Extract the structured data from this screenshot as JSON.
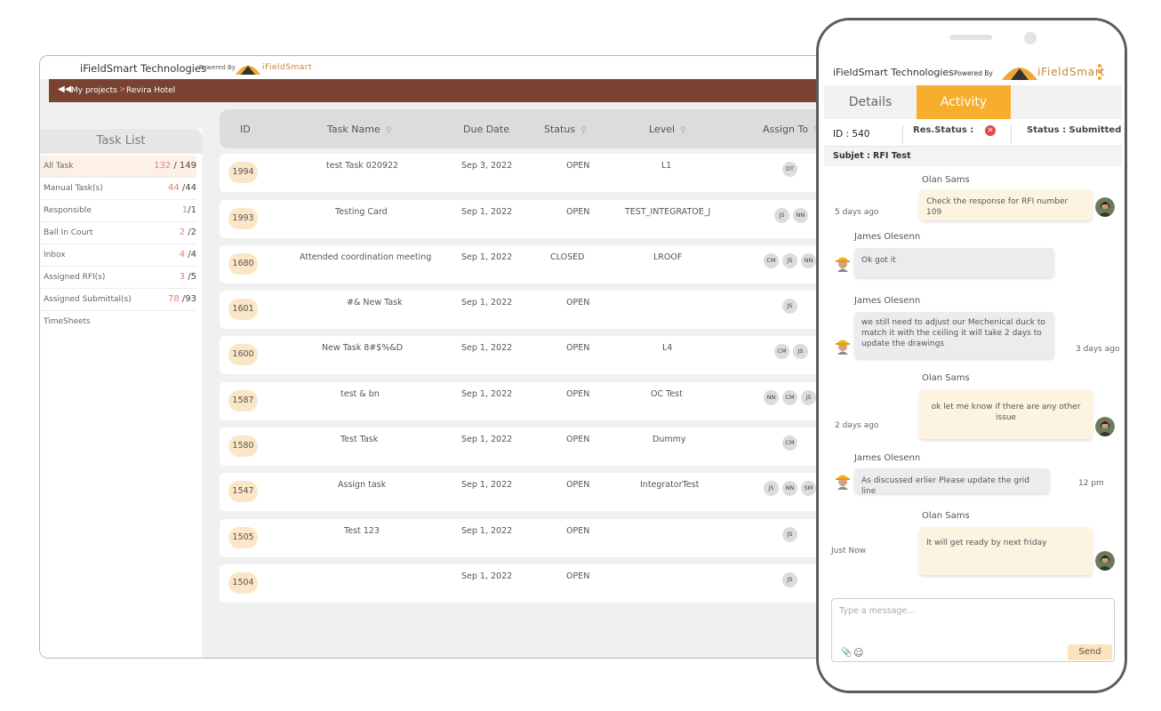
{
  "desktop": {
    "company": "iFieldSmart Technologies",
    "powered_by": "Powered By",
    "logo_text": "iFieldSmart",
    "breadcrumb": {
      "back_icon": "double-left-arrow-icon",
      "parent": "My projects",
      "separator": ">",
      "current": "Revira Hotel"
    },
    "task_list": {
      "title": "Task List",
      "items": [
        {
          "label": "All Task",
          "count": "132",
          "total": "149"
        },
        {
          "label": "Manual Task(s)",
          "count": "44",
          "total": "44"
        },
        {
          "label": "Responsible",
          "count": "1",
          "total": "1"
        },
        {
          "label": "Ball In Court",
          "count": "2",
          "total": "2"
        },
        {
          "label": "Inbox",
          "count": "4",
          "total": "4"
        },
        {
          "label": "Assigned RFI(s)",
          "count": "3",
          "total": "5"
        },
        {
          "label": "Assigned Submittal(s)",
          "count": "78",
          "total": "93"
        },
        {
          "label": "TimeSheets",
          "count": "",
          "total": ""
        }
      ]
    },
    "table": {
      "headers": {
        "id": "ID",
        "task_name": "Task Name",
        "due_date": "Due Date",
        "status": "Status",
        "level": "Level",
        "assign_to": "Assign To"
      },
      "rows": [
        {
          "id": "1994",
          "name": "test Task 020922",
          "due": "Sep 3, 2022",
          "status": "OPEN",
          "level": "L1",
          "assignees": [
            "DT"
          ]
        },
        {
          "id": "1993",
          "name": "Testing Card",
          "due": "Sep 1, 2022",
          "status": "OPEN",
          "level": "TEST_INTEGRATOE_J",
          "assignees": [
            "JS",
            "NN"
          ]
        },
        {
          "id": "1680",
          "name": "Attended coordination meeting",
          "due": "Sep 1, 2022",
          "status": "CLOSED",
          "level": "LROOF",
          "assignees": [
            "CM",
            "JS",
            "NN"
          ]
        },
        {
          "id": "1601",
          "name": "#& New Task",
          "due": "Sep 1, 2022",
          "status": "OPEN",
          "level": "",
          "assignees": [
            "JS"
          ]
        },
        {
          "id": "1600",
          "name": "New Task 8#$%&D",
          "due": "Sep 1, 2022",
          "status": "OPEN",
          "level": "L4",
          "assignees": [
            "CM",
            "JS"
          ]
        },
        {
          "id": "1587",
          "name": "test & bn",
          "due": "Sep 1, 2022",
          "status": "OPEN",
          "level": "OC Test",
          "assignees": [
            "NN",
            "CM",
            "JS"
          ]
        },
        {
          "id": "1580",
          "name": "Test Task",
          "due": "Sep 1, 2022",
          "status": "OPEN",
          "level": "Dummy",
          "assignees": [
            "CM"
          ]
        },
        {
          "id": "1547",
          "name": "Assign task",
          "due": "Sep 1, 2022",
          "status": "OPEN",
          "level": "IntegratorTest",
          "assignees": [
            "JS",
            "NN",
            "SM"
          ]
        },
        {
          "id": "1505",
          "name": "Test 123",
          "due": "Sep 1, 2022",
          "status": "OPEN",
          "level": "",
          "assignees": [
            "JS"
          ]
        },
        {
          "id": "1504",
          "name": "",
          "due": "Sep 1, 2022",
          "status": "OPEN",
          "level": "",
          "assignees": [
            "JS"
          ]
        }
      ]
    }
  },
  "phone": {
    "company": "iFieldSmart Technologies",
    "powered_by": "Powered By",
    "logo_text": "iFieldSmart",
    "tabs": {
      "details": "Details",
      "activity": "Activity"
    },
    "info": {
      "id": "ID : 540",
      "res_status": "Res.Status :",
      "status": "Status : Submitted"
    },
    "subject": "Subjet : RFI Test",
    "messages": [
      {
        "sender": "Olan Sams",
        "text": "Check the response for RFI number 109",
        "time": "5 days ago"
      },
      {
        "sender": "James Olesenn",
        "text": "Ok got it",
        "time": ""
      },
      {
        "sender": "James Olesenn",
        "text": "we still need to adjust our Mechenical duck to match it with the ceiling it will take 2 days to update the drawings",
        "time": "3 days ago"
      },
      {
        "sender": "Olan Sams",
        "text": "ok let me know if there are any other issue",
        "time": "2 days ago"
      },
      {
        "sender": "James Olesenn",
        "text": "As discussed erlier Please update the grid line",
        "time": "12 pm"
      },
      {
        "sender": "Olan Sams",
        "text": "It will get ready by next friday",
        "time": "Just Now"
      }
    ],
    "composer": {
      "placeholder": "Type a message...",
      "send_label": "Send"
    }
  },
  "colors": {
    "accent": "#f8ae2d",
    "breadcrumb_bar": "#7a4230",
    "count_red": "#e9826b",
    "id_pill": "#fbe6c7"
  }
}
